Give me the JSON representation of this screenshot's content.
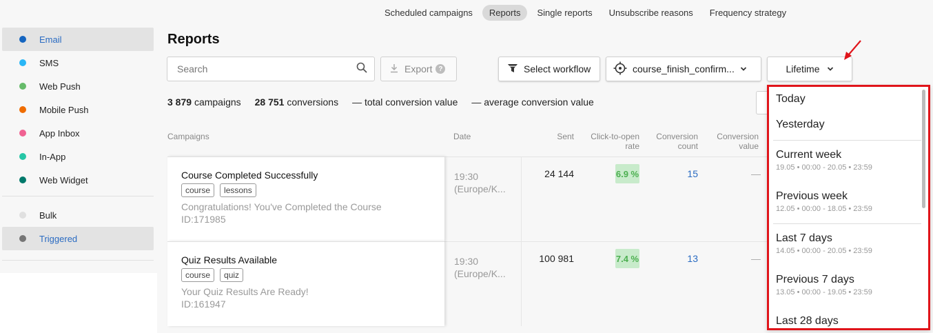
{
  "topnav": {
    "tabs": [
      {
        "label": "Scheduled campaigns",
        "active": false
      },
      {
        "label": "Reports",
        "active": true
      },
      {
        "label": "Single reports",
        "active": false
      },
      {
        "label": "Unsubscribe reasons",
        "active": false
      },
      {
        "label": "Frequency strategy",
        "active": false
      }
    ]
  },
  "sidebar": {
    "channels": [
      {
        "label": "Email",
        "color": "#1565c0",
        "active": true
      },
      {
        "label": "SMS",
        "color": "#29b6f6",
        "active": false
      },
      {
        "label": "Web Push",
        "color": "#66bb6a",
        "active": false
      },
      {
        "label": "Mobile Push",
        "color": "#ef6c00",
        "active": false
      },
      {
        "label": "App Inbox",
        "color": "#f06292",
        "active": false
      },
      {
        "label": "In-App",
        "color": "#26c6a6",
        "active": false
      },
      {
        "label": "Web Widget",
        "color": "#00796b",
        "active": false
      }
    ],
    "types": [
      {
        "label": "Bulk",
        "color": "#e0e0e0",
        "active": false
      },
      {
        "label": "Triggered",
        "color": "#757575",
        "active": true
      }
    ]
  },
  "page": {
    "title": "Reports"
  },
  "toolbar": {
    "search_placeholder": "Search",
    "export_label": "Export",
    "export_help": "?",
    "workflow_label": "Select workflow",
    "course_label": "course_finish_confirm...",
    "period_label": "Lifetime"
  },
  "stats": {
    "campaigns_count": "3 879",
    "campaigns_label": "campaigns",
    "conversions_count": "28 751",
    "conversions_label": "conversions",
    "total_value": "— total conversion value",
    "average_value": "— average conversion value"
  },
  "table": {
    "headers": {
      "campaigns": "Campaigns",
      "date": "Date",
      "sent": "Sent",
      "ctor_line1": "Click-to-open",
      "ctor_line2": "rate",
      "conv_count_line1": "Conversion",
      "conv_count_line2": "count",
      "conv_value_line1": "Conversion",
      "conv_value_line2": "value"
    },
    "rows": [
      {
        "name": "Course Completed Successfully",
        "tags": [
          "course",
          "lessons"
        ],
        "subject": "Congratulations! You've Completed the Course",
        "id": "ID:171985",
        "time": "19:30",
        "tz": "(Europe/K...",
        "sent": "24 144",
        "ctor": "6.9 %",
        "conversions": "15",
        "value": "—"
      },
      {
        "name": "Quiz Results Available",
        "tags": [
          "course",
          "quiz"
        ],
        "subject": "Your Quiz Results Are Ready!",
        "id": "ID:161947",
        "time": "19:30",
        "tz": "(Europe/K...",
        "sent": "100 981",
        "ctor": "7.4 %",
        "conversions": "13",
        "value": "—"
      }
    ]
  },
  "period_dropdown": {
    "options": [
      {
        "label": "Today",
        "range": ""
      },
      {
        "label": "Yesterday",
        "range": ""
      },
      {
        "label": "Current week",
        "range": "19.05 • 00:00 - 20.05 • 23:59"
      },
      {
        "label": "Previous week",
        "range": "12.05 • 00:00 - 18.05 • 23:59"
      },
      {
        "label": "Last 7 days",
        "range": "14.05 • 00:00 - 20.05 • 23:59"
      },
      {
        "label": "Previous 7 days",
        "range": "13.05 • 00:00 - 19.05 • 23:59"
      },
      {
        "label": "Last 28 days",
        "range": ""
      }
    ],
    "highlight_color": "#e0141a"
  }
}
